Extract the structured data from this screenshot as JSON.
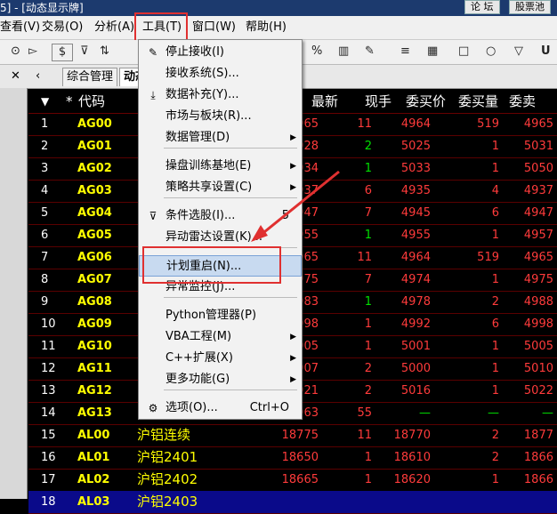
{
  "window": {
    "title": "5] - [动态显示牌]",
    "btn1": "论 坛",
    "btn2": "股票池"
  },
  "menubar": [
    "查看(V)",
    "交易(O)",
    "分析(A)",
    "工具(T)",
    "窗口(W)",
    "帮助(H)"
  ],
  "toolbar": {
    "dollar": "$",
    "percent": "%",
    "unit": "U"
  },
  "tabs": {
    "tab1": "综合管理",
    "tab2": "动态"
  },
  "columns": {
    "code": "代码",
    "latest": "最新",
    "current": "现手",
    "bid": "委买价",
    "bidvol": "委买量",
    "ask": "委卖",
    "star": "*"
  },
  "rows": [
    {
      "no": "1",
      "code": "AG00",
      "name": "",
      "latest": "4965",
      "cur": "11",
      "bid": "4964",
      "bv": "519",
      "ask": "4965",
      "curc": "red"
    },
    {
      "no": "2",
      "code": "AG01",
      "name": "",
      "latest": "5028",
      "cur": "2",
      "bid": "5025",
      "bv": "1",
      "ask": "5031",
      "curc": "green"
    },
    {
      "no": "3",
      "code": "AG02",
      "name": "",
      "latest": "5034",
      "cur": "1",
      "bid": "5033",
      "bv": "1",
      "ask": "5050",
      "curc": "green"
    },
    {
      "no": "4",
      "code": "AG03",
      "name": "",
      "latest": "4937",
      "cur": "6",
      "bid": "4935",
      "bv": "4",
      "ask": "4937",
      "curc": "red"
    },
    {
      "no": "5",
      "code": "AG04",
      "name": "",
      "latest": "4947",
      "cur": "7",
      "bid": "4945",
      "bv": "6",
      "ask": "4947",
      "curc": "red"
    },
    {
      "no": "6",
      "code": "AG05",
      "name": "",
      "latest": "4955",
      "cur": "1",
      "bid": "4955",
      "bv": "1",
      "ask": "4957",
      "curc": "green"
    },
    {
      "no": "7",
      "code": "AG06",
      "name": "",
      "latest": "4965",
      "cur": "11",
      "bid": "4964",
      "bv": "519",
      "ask": "4965",
      "curc": "red"
    },
    {
      "no": "8",
      "code": "AG07",
      "name": "",
      "latest": "4975",
      "cur": "7",
      "bid": "4974",
      "bv": "1",
      "ask": "4975",
      "curc": "red"
    },
    {
      "no": "9",
      "code": "AG08",
      "name": "",
      "latest": "4983",
      "cur": "1",
      "bid": "4978",
      "bv": "2",
      "ask": "4988",
      "curc": "green"
    },
    {
      "no": "10",
      "code": "AG09",
      "name": "",
      "latest": "4998",
      "cur": "1",
      "bid": "4992",
      "bv": "6",
      "ask": "4998",
      "curc": "red"
    },
    {
      "no": "11",
      "code": "AG10",
      "name": "",
      "latest": "5005",
      "cur": "1",
      "bid": "5001",
      "bv": "1",
      "ask": "5005",
      "curc": "red"
    },
    {
      "no": "12",
      "code": "AG11",
      "name": "",
      "latest": "5007",
      "cur": "2",
      "bid": "5000",
      "bv": "1",
      "ask": "5010",
      "curc": "red"
    },
    {
      "no": "13",
      "code": "AG12",
      "name": "",
      "latest": "5021",
      "cur": "2",
      "bid": "5016",
      "bv": "1",
      "ask": "5022",
      "curc": "red"
    },
    {
      "no": "14",
      "code": "AG13",
      "name": "",
      "latest": "4963",
      "cur": "55",
      "bid": "—",
      "bv": "—",
      "ask": "—",
      "curc": "red"
    },
    {
      "no": "15",
      "code": "AL00",
      "name": "沪铝连续",
      "latest": "18775",
      "cur": "11",
      "bid": "18770",
      "bv": "2",
      "ask": "1877",
      "curc": "red"
    },
    {
      "no": "16",
      "code": "AL01",
      "name": "沪铝2401",
      "latest": "18650",
      "cur": "1",
      "bid": "18610",
      "bv": "2",
      "ask": "1866",
      "curc": "red"
    },
    {
      "no": "17",
      "code": "AL02",
      "name": "沪铝2402",
      "latest": "18665",
      "cur": "1",
      "bid": "18620",
      "bv": "1",
      "ask": "1866",
      "curc": "red"
    },
    {
      "no": "18",
      "code": "AL03",
      "name": "沪铝2403",
      "latest": "",
      "cur": "",
      "bid": "",
      "bv": "",
      "ask": "",
      "curc": "red"
    }
  ],
  "menu": {
    "items": [
      {
        "label": "停止接收(I)",
        "icon": "pencil-icon"
      },
      {
        "label": "接收系统(S)..."
      },
      {
        "label": "数据补充(Y)...",
        "icon": "download-icon"
      },
      {
        "label": "市场与板块(R)..."
      },
      {
        "label": "数据管理(D)",
        "sub": true
      },
      {
        "label": "操盘训练基地(E)",
        "sub": true
      },
      {
        "label": "策略共享设置(C)",
        "sub": true
      },
      {
        "label": "条件选股(I)...",
        "icon": "filter-icon",
        "sc": "5"
      },
      {
        "label": "异动雷达设置(K)..."
      },
      {
        "label": "计划重启(N)...",
        "highlight": true
      },
      {
        "label": "异常监控(J)..."
      },
      {
        "label": "Python管理器(P)"
      },
      {
        "label": "VBA工程(M)",
        "sub": true
      },
      {
        "label": "C++扩展(X)",
        "sub": true
      },
      {
        "label": "更多功能(G)",
        "sub": true
      },
      {
        "label": "选项(O)...",
        "icon": "gear-icon",
        "sc": "Ctrl+O"
      }
    ]
  }
}
